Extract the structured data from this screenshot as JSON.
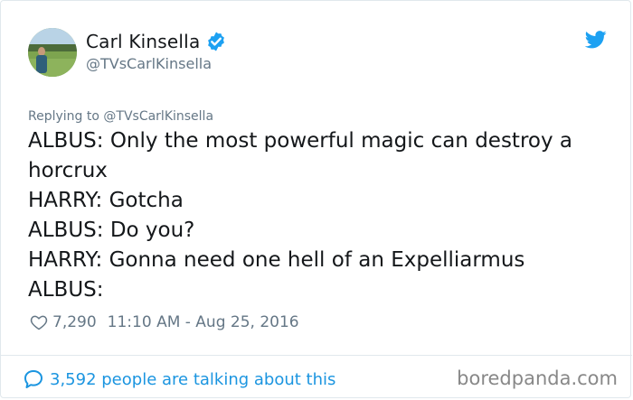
{
  "author": {
    "name": "Carl Kinsella",
    "handle": "@TVsCarlKinsella",
    "verified": true
  },
  "reply": {
    "prefix": "Replying to ",
    "mention": "@TVsCarlKinsella"
  },
  "body": {
    "lines": [
      "ALBUS: Only the most powerful magic can destroy a",
      "horcrux",
      "HARRY: Gotcha",
      "ALBUS: Do you?",
      "HARRY: Gonna need one hell of an Expelliarmus",
      "ALBUS:"
    ]
  },
  "meta": {
    "likes": "7,290",
    "timestamp": "11:10 AM - Aug 25, 2016"
  },
  "footer": {
    "talking": "3,592 people are talking about this"
  },
  "watermark": "boredpanda.com",
  "colors": {
    "twitter_blue": "#1da1f2",
    "link_blue": "#1b95e0",
    "muted": "#657786",
    "text": "#14171a"
  },
  "icons": {
    "bird": "twitter-bird-icon",
    "verified": "verified-badge-icon",
    "heart": "heart-outline-icon",
    "bubble": "speech-bubble-icon"
  }
}
